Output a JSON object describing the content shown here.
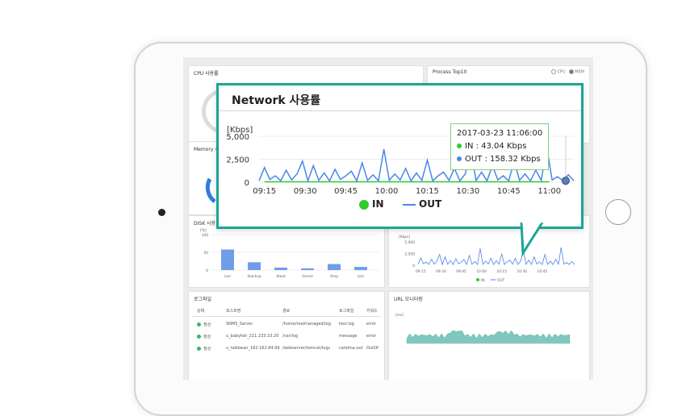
{
  "dashboard": {
    "cpu_title": "CPU 사용률",
    "memory_title": "Memory 사",
    "disk_title": "DISK 사용",
    "process_title": "Process Top10",
    "process_opts": [
      "CPU",
      "MEM"
    ],
    "disk_chart": {
      "ylabel": "[%]",
      "yticks": [
        "100",
        "50",
        "0"
      ],
      "categories": [
        "/usr",
        "/backup",
        "/boot",
        "/home",
        "/tmp",
        "/var"
      ],
      "values": [
        58,
        22,
        7,
        5,
        17,
        9
      ]
    },
    "mini_network": {
      "ylabel": "[Kbps]",
      "yticks": [
        "5,000",
        "2,500",
        "0"
      ],
      "xticks": [
        "09:15",
        "09:30",
        "09:45",
        "10:00",
        "10:15",
        "10:30",
        "10:45"
      ],
      "legend_in": "IN",
      "legend_out": "OUT"
    },
    "log_file": {
      "title": "로그파일",
      "headers": [
        "상태",
        "호스트명",
        "경로",
        "로그파일",
        "키워드"
      ],
      "rows": [
        [
          "정상",
          "SNMS_Server",
          "/home/realmanaged/log",
          "test.log",
          "error"
        ],
        [
          "정상",
          "u_babyfair_211.233.10.20",
          "/var/log",
          "message",
          "error"
        ],
        [
          "정상",
          "u_talkbean_182.162.84.99",
          "/webserver/tomcat/logs",
          "catalina.out",
          "OutOf"
        ]
      ]
    },
    "url_monitoring": {
      "title": "URL 모니터링",
      "ylabel": "[ms]"
    }
  },
  "popup": {
    "title": "Network 사용률",
    "tooltip": {
      "time": "2017-03-23 11:06:00",
      "in": "IN : 43.04 Kbps",
      "out": "OUT : 158.32 Kbps"
    },
    "legend_in": "IN",
    "legend_out": "OUT",
    "colors": {
      "accent": "#1aa596",
      "in": "#2ecc2e",
      "out": "#4a86e8"
    }
  },
  "chart_data": {
    "type": "line",
    "title": "Network 사용률",
    "ylabel": "[Kbps]",
    "yticks": [
      0,
      2500,
      5000
    ],
    "ylim": [
      0,
      5000
    ],
    "xticks": [
      "09:15",
      "09:30",
      "09:45",
      "10:00",
      "10:15",
      "10:30",
      "10:45",
      "11:00"
    ],
    "series": [
      {
        "name": "IN",
        "color": "#2ecc2e",
        "x": [
          "09:15",
          "09:30",
          "09:45",
          "10:00",
          "10:15",
          "10:30",
          "10:45",
          "11:00"
        ],
        "values": [
          40,
          40,
          45,
          40,
          42,
          40,
          41,
          43
        ]
      },
      {
        "name": "OUT",
        "color": "#4a86e8",
        "x": [
          "09:13",
          "09:15",
          "09:17",
          "09:19",
          "09:21",
          "09:23",
          "09:25",
          "09:27",
          "09:29",
          "09:31",
          "09:33",
          "09:35",
          "09:37",
          "09:39",
          "09:41",
          "09:43",
          "09:45",
          "09:47",
          "09:49",
          "09:51",
          "09:53",
          "09:55",
          "09:57",
          "09:59",
          "10:01",
          "10:03",
          "10:05",
          "10:07",
          "10:09",
          "10:11",
          "10:13",
          "10:15",
          "10:17",
          "10:19",
          "10:21",
          "10:23",
          "10:25",
          "10:27",
          "10:29",
          "10:31",
          "10:33",
          "10:35",
          "10:37",
          "10:39",
          "10:41",
          "10:43",
          "10:45",
          "10:47",
          "10:49",
          "10:51",
          "10:53",
          "10:55",
          "10:57",
          "10:59",
          "11:01",
          "11:03",
          "11:05",
          "11:07",
          "11:09"
        ],
        "values": [
          150,
          1600,
          300,
          700,
          150,
          1300,
          250,
          900,
          2300,
          150,
          1800,
          200,
          1000,
          150,
          1400,
          300,
          700,
          1200,
          150,
          2100,
          200,
          800,
          150,
          3600,
          200,
          900,
          250,
          1500,
          150,
          1000,
          200,
          2400,
          150,
          700,
          1100,
          200,
          1500,
          150,
          900,
          3400,
          200,
          1100,
          150,
          1800,
          250,
          700,
          150,
          2300,
          200,
          900,
          150,
          1300,
          200,
          3800,
          250,
          600,
          160,
          800,
          158
        ]
      }
    ]
  }
}
